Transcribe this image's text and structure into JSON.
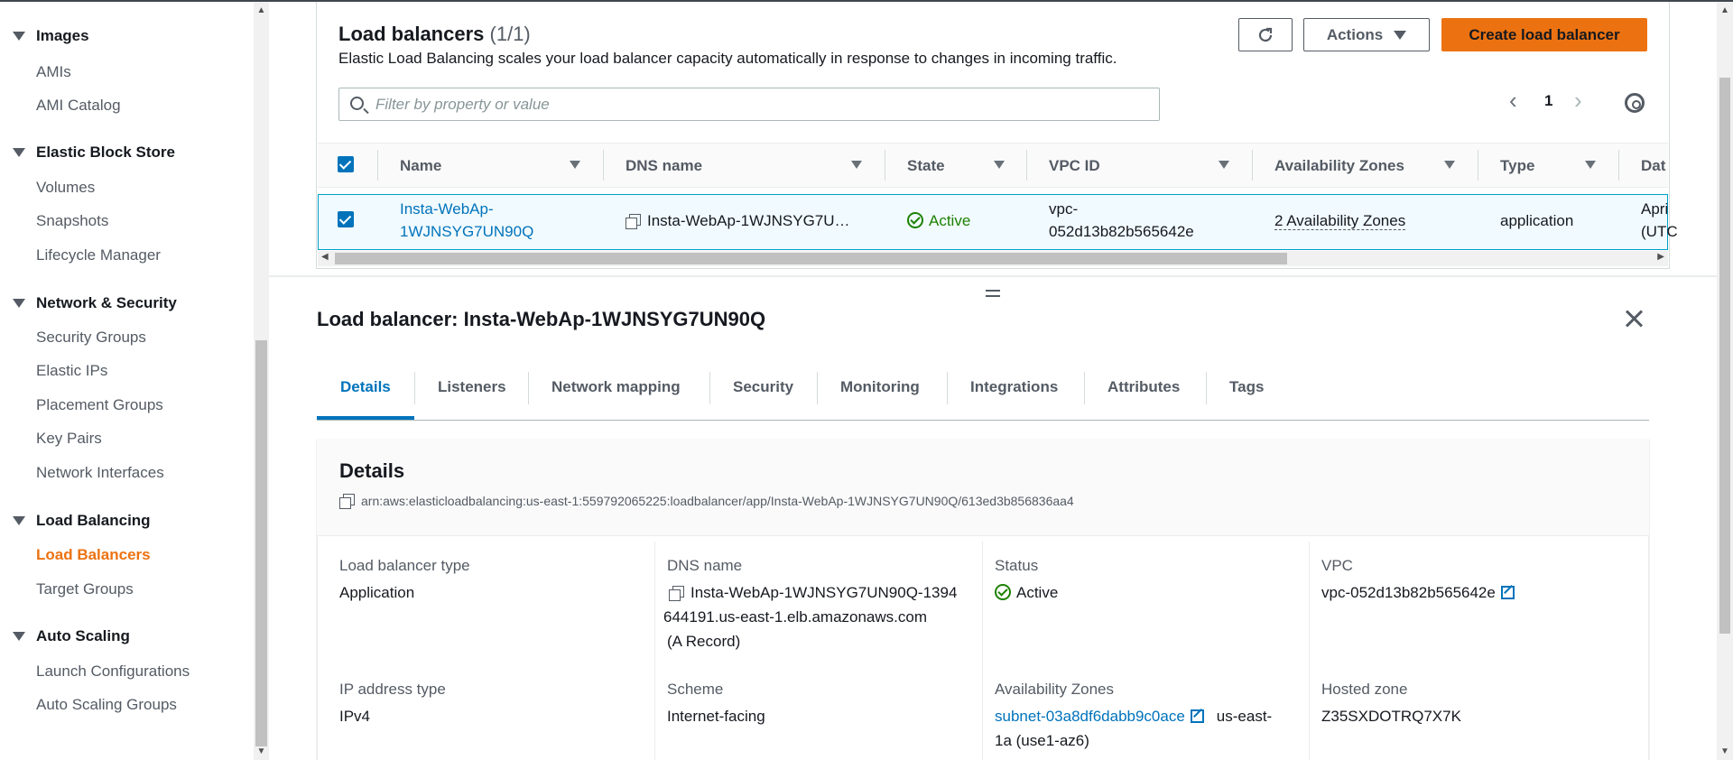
{
  "sidebar": {
    "sections": [
      {
        "title": "Images",
        "items": [
          "AMIs",
          "AMI Catalog"
        ]
      },
      {
        "title": "Elastic Block Store",
        "items": [
          "Volumes",
          "Snapshots",
          "Lifecycle Manager"
        ]
      },
      {
        "title": "Network & Security",
        "items": [
          "Security Groups",
          "Elastic IPs",
          "Placement Groups",
          "Key Pairs",
          "Network Interfaces"
        ]
      },
      {
        "title": "Load Balancing",
        "items": [
          "Load Balancers",
          "Target Groups"
        ]
      },
      {
        "title": "Auto Scaling",
        "items": [
          "Launch Configurations",
          "Auto Scaling Groups"
        ]
      }
    ],
    "active_item": "Load Balancers"
  },
  "lb_panel": {
    "title": "Load balancers",
    "count": "(1/1)",
    "description": "Elastic Load Balancing scales your load balancer capacity automatically in response to changes in incoming traffic.",
    "actions_label": "Actions",
    "create_label": "Create load balancer",
    "filter_placeholder": "Filter by property or value",
    "page": "1"
  },
  "table": {
    "columns": [
      "Name",
      "DNS name",
      "State",
      "VPC ID",
      "Availability Zones",
      "Type",
      "Dat"
    ],
    "row": {
      "name_line1": "Insta-WebAp-",
      "name_line2": "1WJNSYG7UN90Q",
      "dns": "Insta-WebAp-1WJNSYG7U…",
      "state": "Active",
      "vpc_line1": "vpc-",
      "vpc_line2": "052d13b82b565642e",
      "azs": "2 Availability Zones",
      "type": "application",
      "date_line1": "Apri",
      "date_line2": "(UTC"
    }
  },
  "detail": {
    "title": "Load balancer: Insta-WebAp-1WJNSYG7UN90Q",
    "tabs": [
      "Details",
      "Listeners",
      "Network mapping",
      "Security",
      "Monitoring",
      "Integrations",
      "Attributes",
      "Tags"
    ],
    "active_tab": "Details",
    "card_title": "Details",
    "arn": "arn:aws:elasticloadbalancing:us-east-1:559792065225:loadbalancer/app/Insta-WebAp-1WJNSYG7UN90Q/613ed3b856836aa4",
    "fields": {
      "lb_type_label": "Load balancer type",
      "lb_type_value": "Application",
      "dns_label": "DNS name",
      "dns_line1": "Insta-WebAp-1WJNSYG7UN90Q-1394",
      "dns_line2": "644191.us-east-1.elb.amazonaws.com",
      "dns_line3": "(A Record)",
      "status_label": "Status",
      "status_value": "Active",
      "vpc_label": "VPC",
      "vpc_value": "vpc-052d13b82b565642e",
      "ip_label": "IP address type",
      "ip_value": "IPv4",
      "scheme_label": "Scheme",
      "scheme_value": "Internet-facing",
      "az_label": "Availability Zones",
      "az_subnet": "subnet-03a8df6dabb9c0ace",
      "az_suffix1": "us-east-",
      "az_suffix2": "1a (use1-az6)",
      "hz_label": "Hosted zone",
      "hz_value": "Z35SXDOTRQ7X7K"
    }
  },
  "colors": {
    "accent": "#0073bb",
    "primary_button": "#ec7211",
    "active_nav": "#ec7211",
    "success": "#1d8102"
  }
}
